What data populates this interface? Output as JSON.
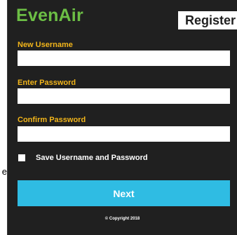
{
  "edge_fragment": "e",
  "header": {
    "logo": "EvenAir",
    "title": "Register"
  },
  "form": {
    "username_label": "New Username",
    "username_value": "",
    "password_label": "Enter Password",
    "password_value": "",
    "confirm_label": "Confirm Password",
    "confirm_value": "",
    "remember_label": "Save Username and Password",
    "remember_checked": false
  },
  "actions": {
    "next_label": "Next"
  },
  "footer": {
    "copyright": "© Copyright 2018"
  },
  "colors": {
    "panel_bg": "#202020",
    "logo_green": "#6cbe45",
    "label_yellow": "#f2b51a",
    "button_blue": "#2fbce3"
  }
}
